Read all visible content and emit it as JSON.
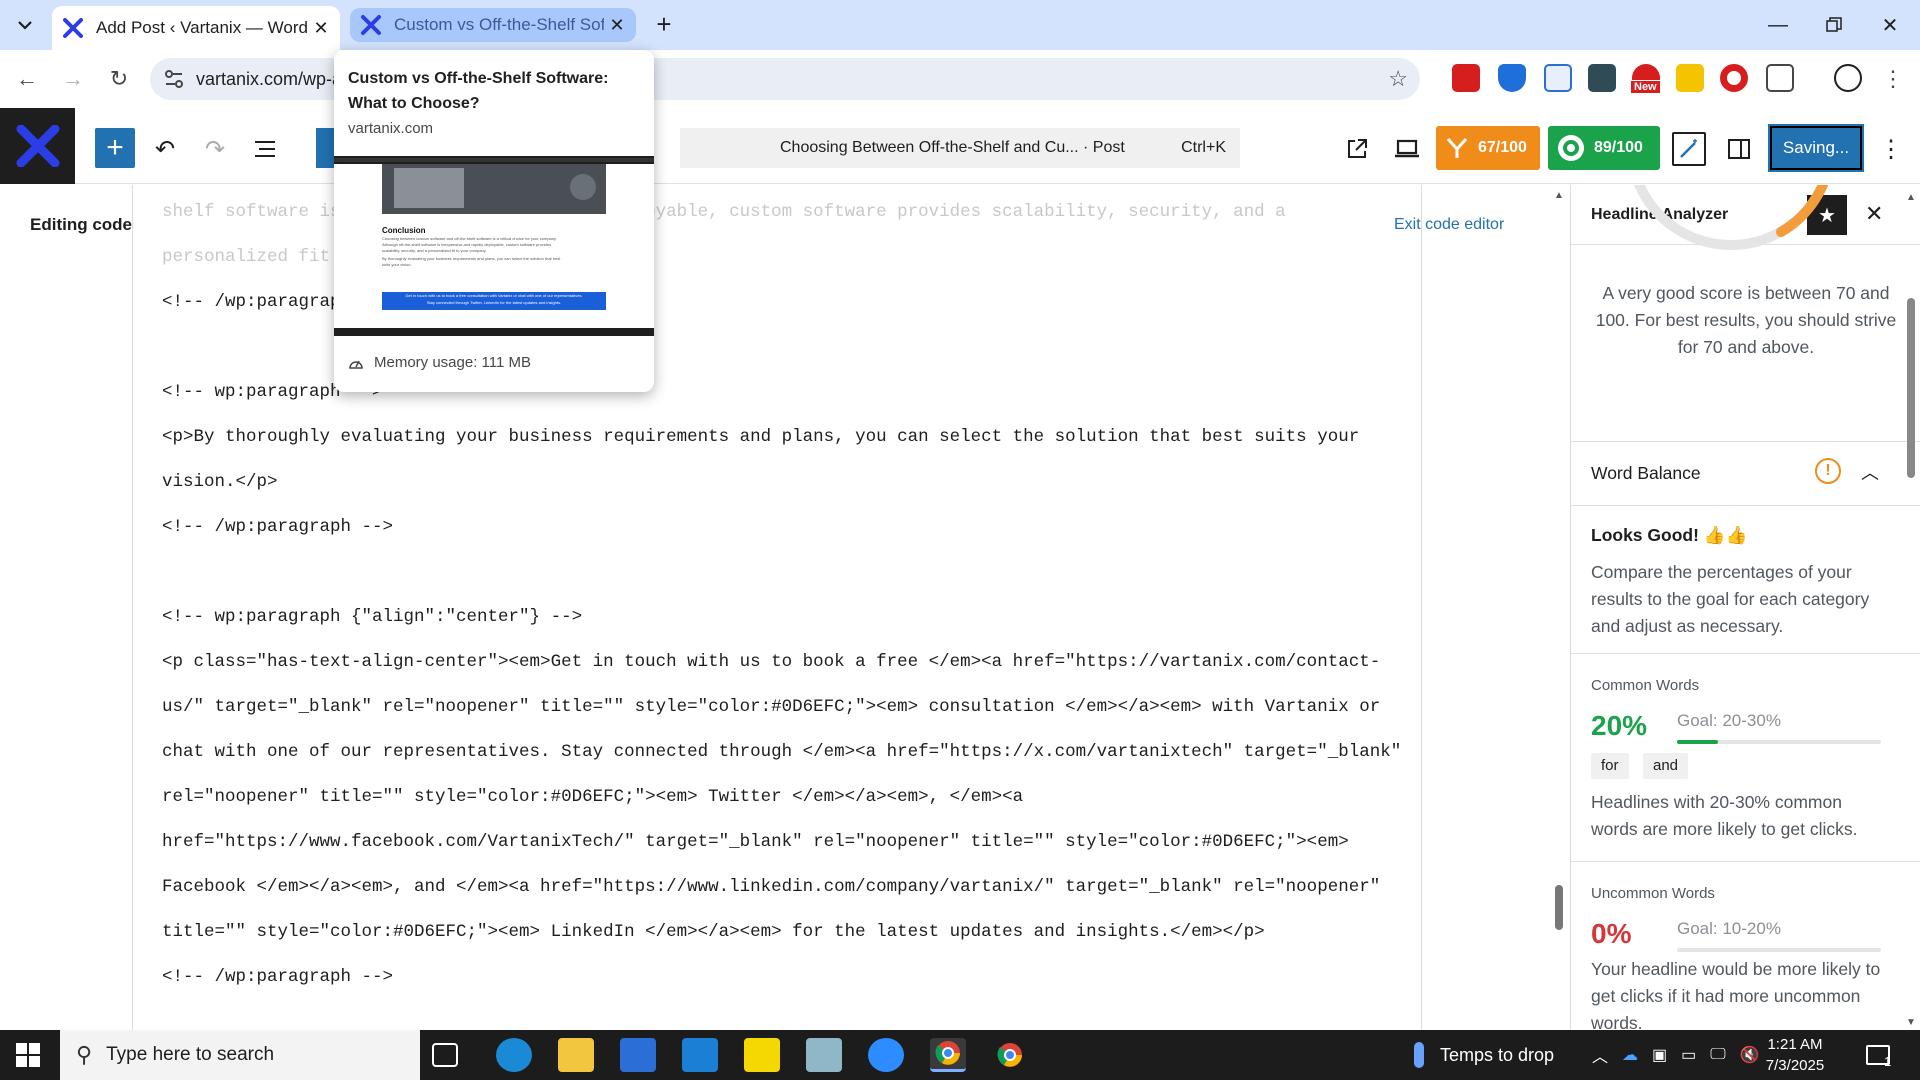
{
  "browser": {
    "tabs": [
      {
        "title": "Add Post ‹ Vartanix — WordPress"
      },
      {
        "title": "Custom vs Off-the-Shelf Software: What to Choose?"
      }
    ],
    "address": "vartanix.com/wp-admin/post-new.php",
    "ext_badge": "New",
    "hover_card": {
      "title": "Custom vs Off-the-Shelf Software: What to Choose?",
      "host": "vartanix.com",
      "memory": "Memory usage: 111 MB",
      "preview": {
        "heading": "Conclusion",
        "lines": [
          "Choosing between custom software and off-the-shelf software is a critical choice for your company.",
          "Although off-the-shelf software is inexpensive and rapidly deployable, custom software provides",
          "scalability, security, and a personalized fit to your company.",
          "By thoroughly evaluating your business requirements and plans, you can select the solution that best",
          "suits your vision.",
          "Get in touch with us to book a free consultation with Vartanix or chat with one of our representatives.",
          "Stay connected through Twitter, LinkedIn for the latest updates and insights."
        ]
      }
    }
  },
  "wp": {
    "command_bar": "Choosing Between Off-the-Shelf and Cu... · Post",
    "shortcut": "Ctrl+K",
    "score1": "67/100",
    "score2": "89/100",
    "save": "Saving...",
    "editing_label": "Editing code",
    "exit_code": "Exit code editor"
  },
  "code_lines": [
    "shelf software is inexpensive and rapidly deployable, custom software provides scalability, security, and a",
    "personalized fit to your company.</p>",
    "<!-- /wp:paragraph -->",
    "<!-- wp:paragraph -->",
    "<p>By thoroughly evaluating your business requirements and plans, you can select the solution that best suits your",
    "vision.</p>",
    "<!-- /wp:paragraph -->",
    "<!-- wp:paragraph {\"align\":\"center\"} -->",
    "<p class=\"has-text-align-center\"><em>Get in touch with us to book a free </em><a href=\"https://vartanix.com/contact-",
    "us/\" target=\"_blank\" rel=\"noopener\" title=\"\" style=\"color:#0D6EFC;\"><em> consultation </em></a><em> with Vartanix or",
    "chat with one of our representatives. Stay connected through </em><a href=\"https://x.com/vartanixtech\" target=\"_blank\"",
    "rel=\"noopener\" title=\"\" style=\"color:#0D6EFC;\"><em> Twitter </em></a><em>, </em><a",
    "href=\"https://www.facebook.com/VartanixTech/\" target=\"_blank\" rel=\"noopener\" title=\"\" style=\"color:#0D6EFC;\"><em>",
    "Facebook </em></a><em>, and </em><a href=\"https://www.linkedin.com/company/vartanix/\" target=\"_blank\" rel=\"noopener\"",
    "title=\"\" style=\"color:#0D6EFC;\"><em> LinkedIn </em></a><em> for the latest updates and insights.</em></p>",
    "<!-- /wp:paragraph -->"
  ],
  "sidebar": {
    "title": "Headline Analyzer",
    "score_note": "A very good score is between 70 and 100. For best results, you should strive for 70 and above.",
    "word_balance": "Word Balance",
    "looks_good": "Looks Good!",
    "compare_text": "Compare the percentages of your results to the goal for each category and adjust as necessary.",
    "common": {
      "label": "Common Words",
      "pct": "20%",
      "goal": "Goal: 20-30%",
      "fill": 0.2,
      "chips": [
        "for",
        "and"
      ],
      "note": "Headlines with 20-30% common words are more likely to get clicks."
    },
    "uncommon": {
      "label": "Uncommon Words",
      "pct": "0%",
      "goal": "Goal: 10-20%",
      "note": "Your headline would be more likely to get clicks if it had more uncommon words."
    }
  },
  "taskbar": {
    "search_placeholder": "Type here to search",
    "weather": "Temps to drop",
    "time": "1:21 AM",
    "date": "7/3/2025",
    "notif_count": "1"
  },
  "colors": {
    "wp_blue": "#2271b1",
    "score_orange": "#f08c1a",
    "score_green": "#1aa34a",
    "pct_green": "#1aa34a",
    "pct_red": "#d63638"
  }
}
